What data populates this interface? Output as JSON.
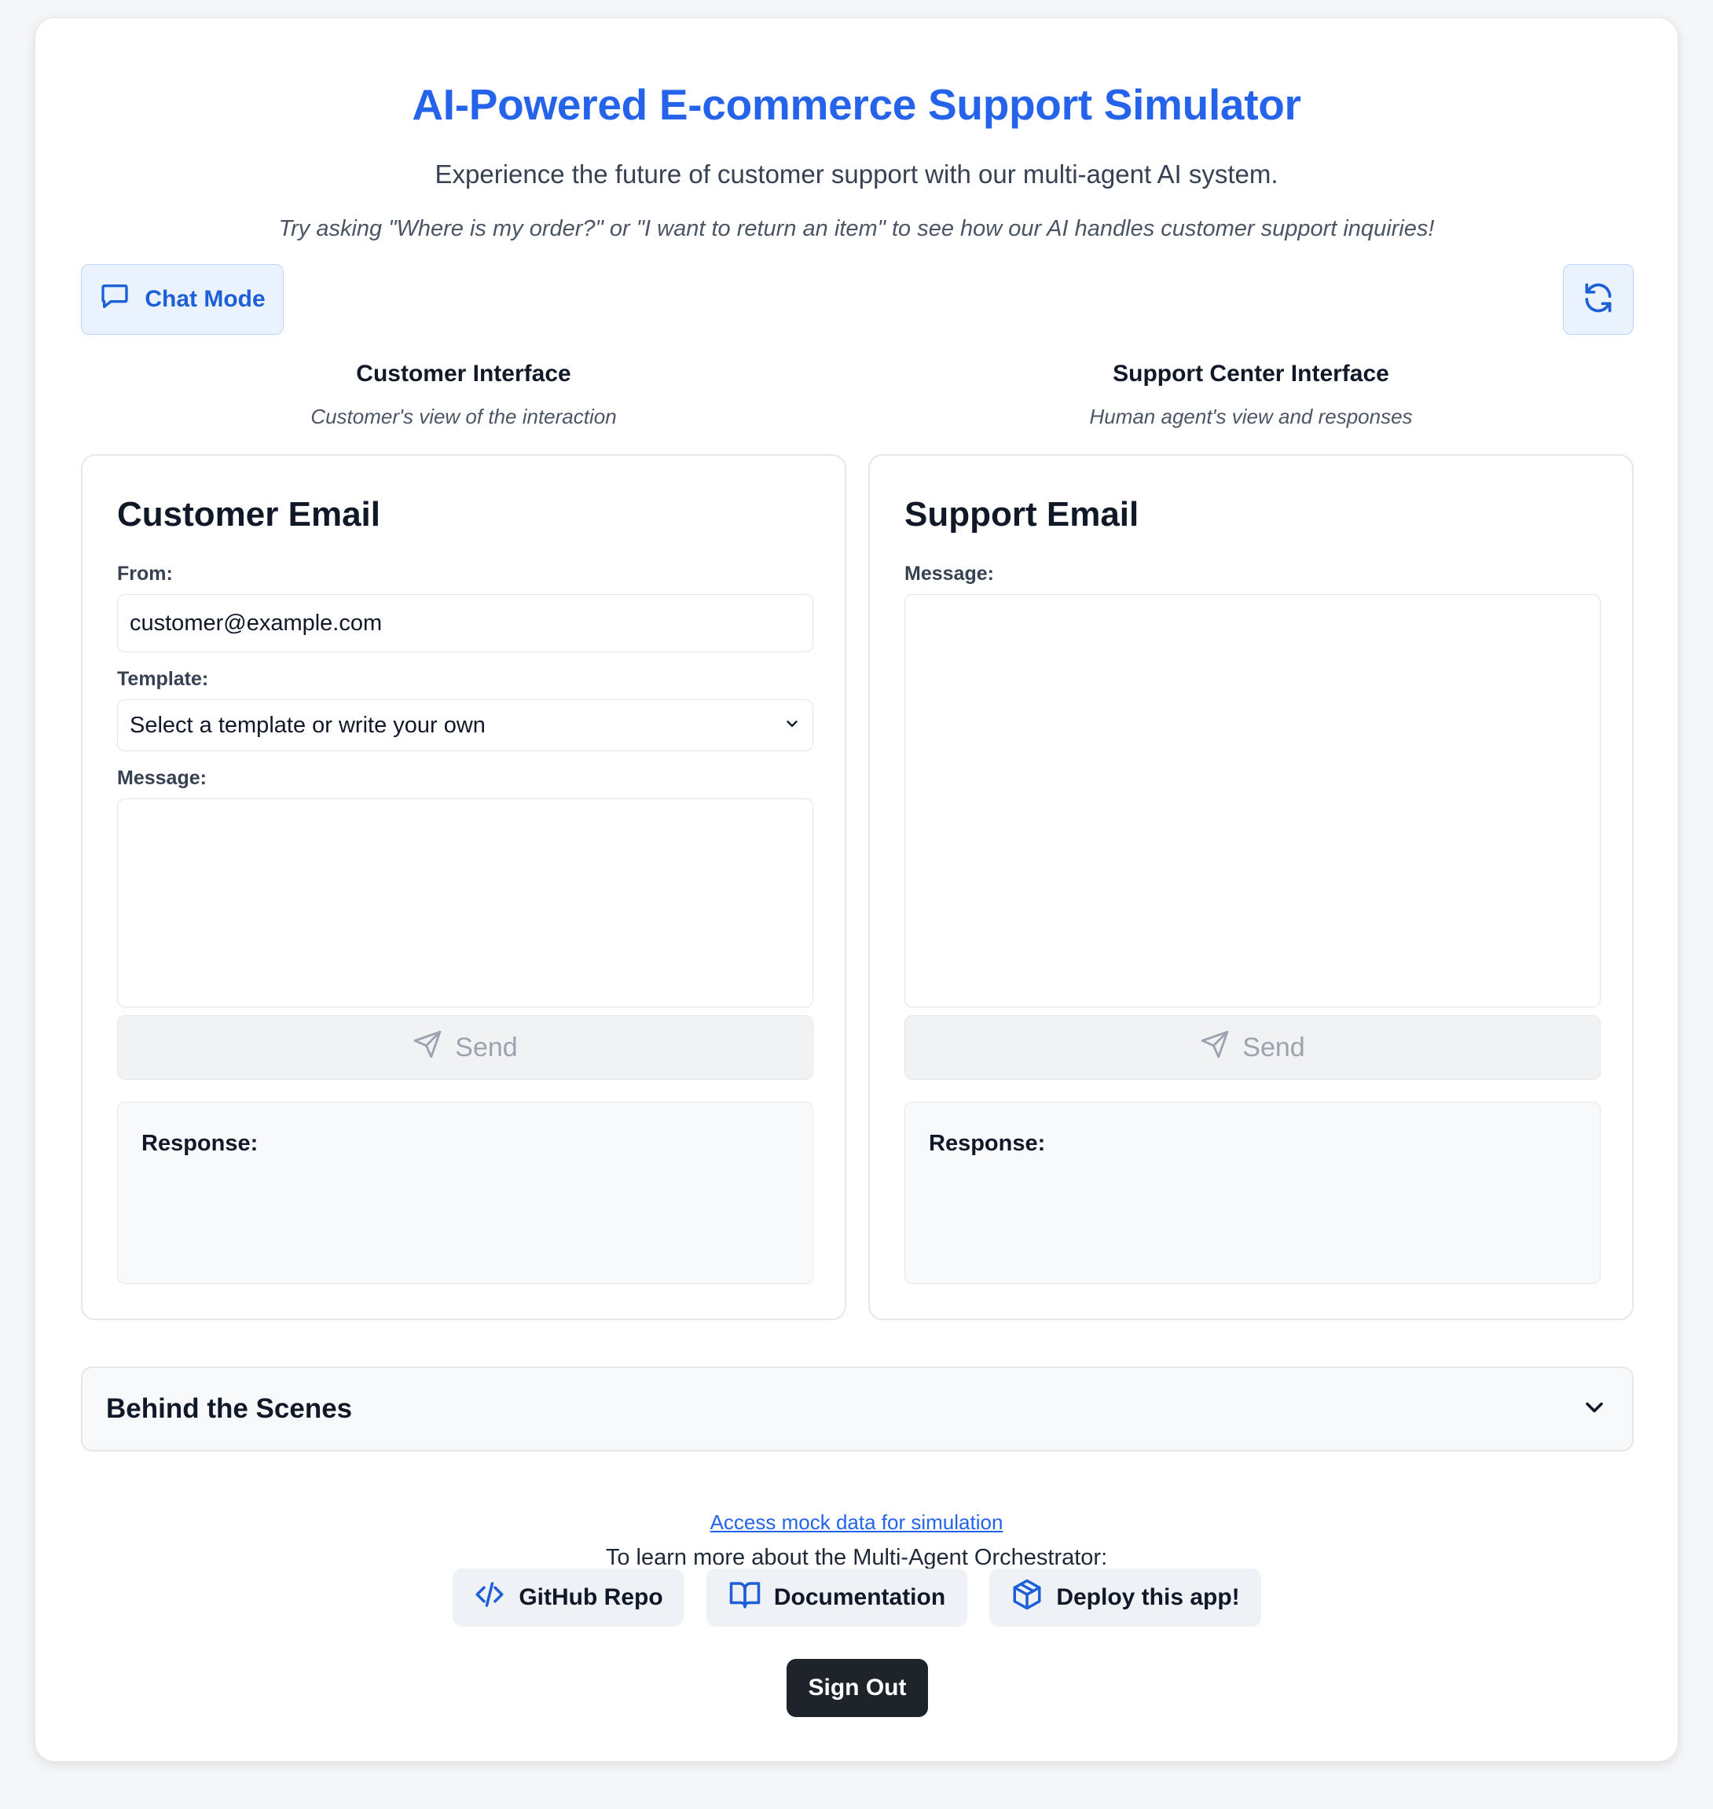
{
  "header": {
    "title": "AI-Powered E-commerce Support Simulator",
    "subtitle": "Experience the future of customer support with our multi-agent AI system.",
    "hint": "Try asking \"Where is my order?\" or \"I want to return an item\" to see how our AI handles customer support inquiries!"
  },
  "toolbar": {
    "chat_mode_label": "Chat Mode",
    "chat_icon": "chat-bubble-icon",
    "refresh_icon": "refresh-icon"
  },
  "customer": {
    "column_title": "Customer Interface",
    "column_subtitle": "Customer's view of the interaction",
    "panel_title": "Customer Email",
    "from_label": "From:",
    "from_value": "customer@example.com",
    "template_label": "Template:",
    "template_selected": "Select a template or write your own",
    "message_label": "Message:",
    "message_value": "",
    "send_label": "Send",
    "response_label": "Response:"
  },
  "support": {
    "column_title": "Support Center Interface",
    "column_subtitle": "Human agent's view and responses",
    "panel_title": "Support Email",
    "message_label": "Message:",
    "message_value": "",
    "send_label": "Send",
    "response_label": "Response:"
  },
  "behind_scenes": {
    "title": "Behind the Scenes"
  },
  "footer": {
    "mock_data_link": "Access mock data for simulation",
    "learn_more": "To learn more about the Multi-Agent Orchestrator:",
    "links": [
      {
        "label": "GitHub Repo",
        "icon": "code-icon"
      },
      {
        "label": "Documentation",
        "icon": "book-icon"
      },
      {
        "label": "Deploy this app!",
        "icon": "package-icon"
      }
    ],
    "sign_out_label": "Sign Out"
  },
  "colors": {
    "accent": "#2563eb",
    "accent_bg": "#eaf2fe",
    "dark_button": "#1f242b"
  }
}
